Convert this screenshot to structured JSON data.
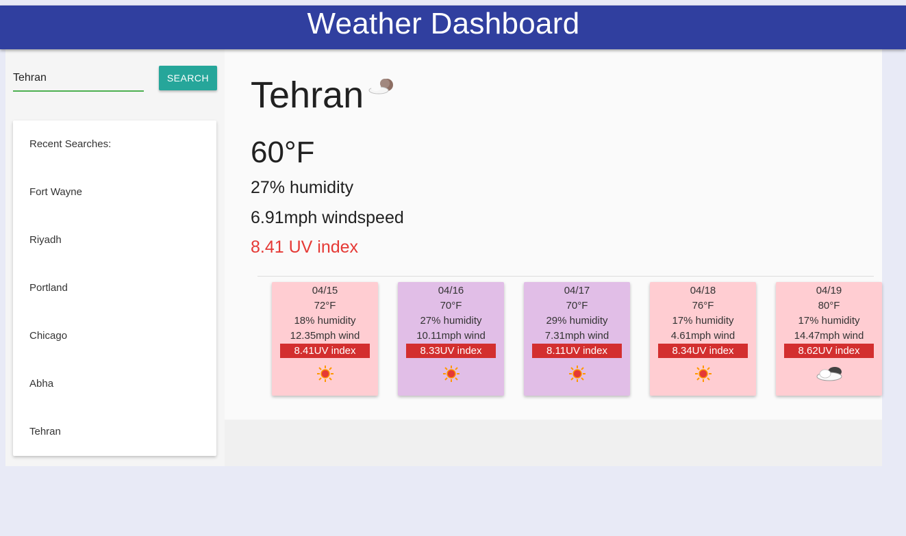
{
  "header": {
    "title": "Weather Dashboard"
  },
  "search": {
    "value": "Tehran",
    "button_label": "SEARCH"
  },
  "recent": {
    "title": "Recent Searches:",
    "items": [
      "Fort Wayne",
      "Riyadh",
      "Portland",
      "Chicago",
      "Abha",
      "Tehran"
    ]
  },
  "current": {
    "city": "Tehran",
    "icon": "cloud-moon-icon",
    "temp": "60°F",
    "humidity": "27% humidity",
    "wind": "6.91mph windspeed",
    "uv": "8.41 UV index"
  },
  "forecast": [
    {
      "date": "04/15",
      "temp": "72°F",
      "humidity": "18% humidity",
      "wind": "12.35mph wind",
      "uv": "8.41UV index",
      "icon": "sun-icon",
      "color": "#ffcdd2"
    },
    {
      "date": "04/16",
      "temp": "70°F",
      "humidity": "27% humidity",
      "wind": "10.11mph wind",
      "uv": "8.33UV index",
      "icon": "sun-icon",
      "color": "#e1bee7"
    },
    {
      "date": "04/17",
      "temp": "70°F",
      "humidity": "29% humidity",
      "wind": "7.31mph wind",
      "uv": "8.11UV index",
      "icon": "sun-icon",
      "color": "#e1bee7"
    },
    {
      "date": "04/18",
      "temp": "76°F",
      "humidity": "17% humidity",
      "wind": "4.61mph wind",
      "uv": "8.34UV index",
      "icon": "sun-icon",
      "color": "#ffcdd2"
    },
    {
      "date": "04/19",
      "temp": "80°F",
      "humidity": "17% humidity",
      "wind": "14.47mph wind",
      "uv": "8.62UV index",
      "icon": "cloud-icon",
      "color": "#ffcdd2"
    }
  ],
  "colors": {
    "header": "#303f9f",
    "search_button": "#26a69a",
    "input_underline": "#4caf50",
    "uv_text": "#e53935",
    "uv_bar": "#d32f2f"
  }
}
